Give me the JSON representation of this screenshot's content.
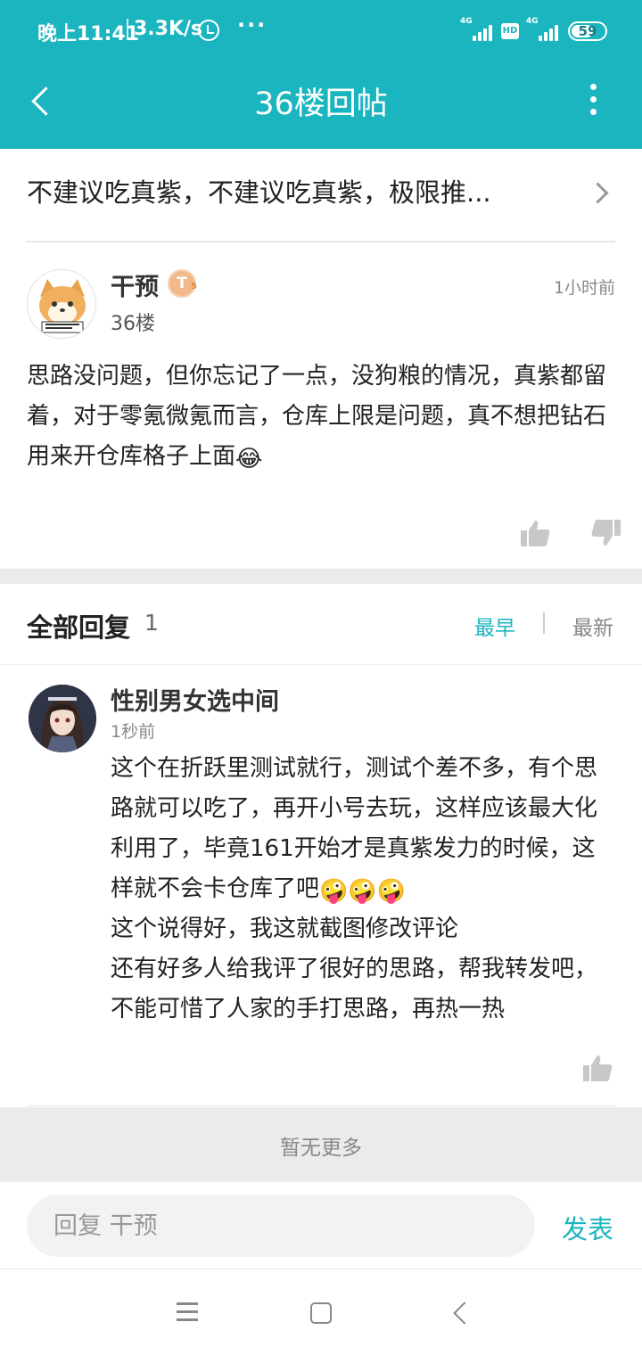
{
  "status_bar": {
    "time": "晚上11:41",
    "speed": "3.3K/s",
    "more": "···",
    "net1": "4G",
    "hd": "HD",
    "net2": "4G",
    "battery": "59"
  },
  "app_bar": {
    "title": "36楼回帖"
  },
  "thread": {
    "title": "不建议吃真紫，不建议吃真紫，极限推..."
  },
  "post": {
    "username": "干预",
    "level_badge": "T",
    "level_sub": "5",
    "floor": "36楼",
    "time": "1小时前",
    "content": "思路没问题，但你忘记了一点，没狗粮的情况，真紫都留着，对于零氪微氪而言，仓库上限是问题，真不想把钻石用来开仓库格子上面",
    "emoji": "😂"
  },
  "replies": {
    "label": "全部回复",
    "count": "1",
    "sort_early": "最早",
    "sort_new": "最新",
    "items": [
      {
        "username": "性别男女选中间",
        "time": "1秒前",
        "line1": "这个在折跃里测试就行，测试个差不多，有个思路就可以吃了，再开小号去玩，这样应该最大化利用了，毕竟161开始才是真紫发力的时候，这样就不会卡仓库了吧",
        "emoji": "🤪🤪🤪",
        "line2": "这个说得好，我这就截图修改评论",
        "line3": "还有好多人给我评了很好的思路，帮我转发吧，不能可惜了人家的手打思路，再热一热"
      }
    ]
  },
  "no_more": "暂无更多",
  "input_bar": {
    "placeholder": "回复 干预",
    "publish": "发表"
  },
  "colors": {
    "accent": "#1bb5bf"
  }
}
